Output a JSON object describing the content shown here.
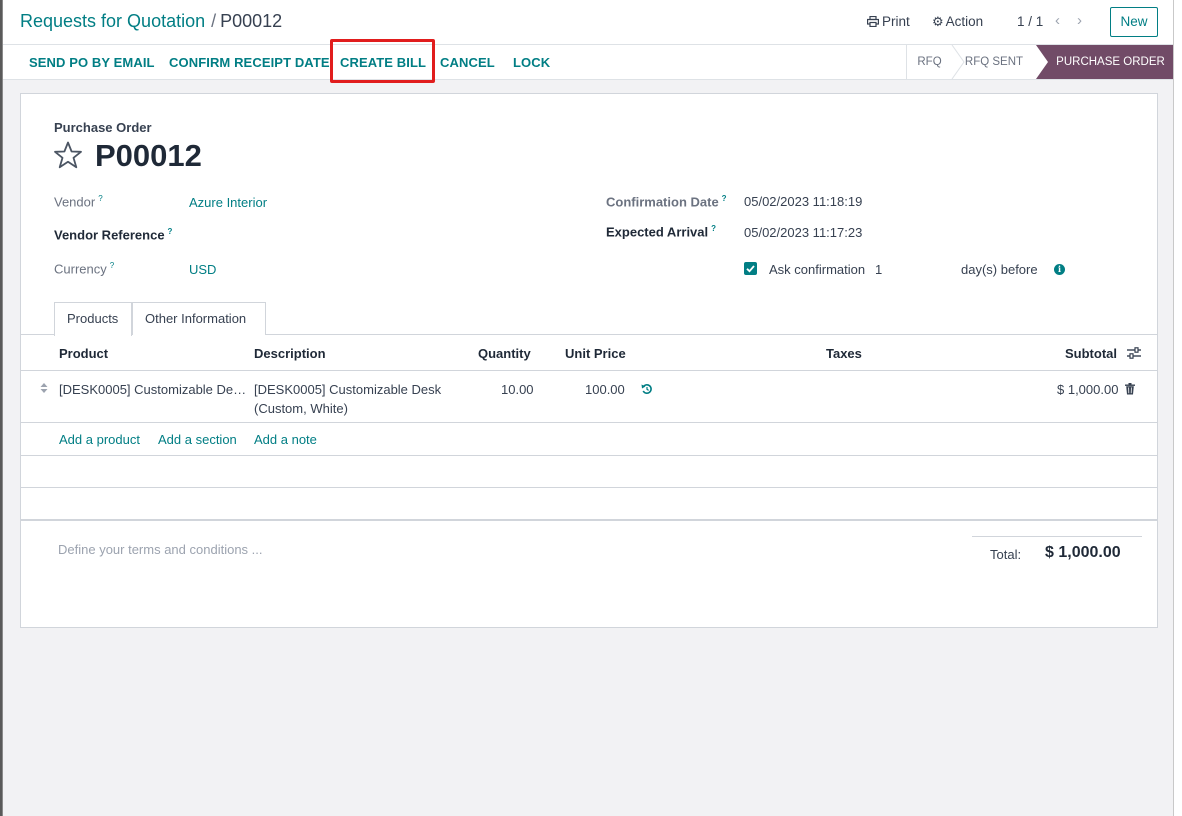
{
  "breadcrumb": {
    "parent": "Requests for Quotation",
    "separator": "/",
    "current": "P00012"
  },
  "header": {
    "print_label": "Print",
    "action_label": "Action",
    "pager": "1 / 1",
    "new_label": "New"
  },
  "statusbar": {
    "buttons": [
      "SEND PO BY EMAIL",
      "CONFIRM RECEIPT DATE",
      "CREATE BILL",
      "CANCEL",
      "LOCK"
    ],
    "stages": [
      "RFQ",
      "RFQ SENT",
      "PURCHASE ORDER"
    ],
    "active_stage": "PURCHASE ORDER",
    "highlighted_button": "CREATE BILL"
  },
  "form": {
    "type_label": "Purchase Order",
    "name": "P00012",
    "vendor_label": "Vendor",
    "vendor_value": "Azure Interior",
    "vendor_ref_label": "Vendor Reference",
    "currency_label": "Currency",
    "currency_value": "USD",
    "confirmation_date_label": "Confirmation Date",
    "confirmation_date_value": "05/02/2023 11:18:19",
    "expected_arrival_label": "Expected Arrival",
    "expected_arrival_value": "05/02/2023 11:17:23",
    "ask_confirmation_label": "Ask confirmation",
    "ask_confirmation_days": "1",
    "days_before_label": "day(s) before",
    "help_mark": "?"
  },
  "tabs": [
    "Products",
    "Other Information"
  ],
  "table": {
    "headers": [
      "Product",
      "Description",
      "Quantity",
      "Unit Price",
      "Taxes",
      "Subtotal"
    ],
    "rows": [
      {
        "product": "[DESK0005] Customizable De…",
        "description_1": "[DESK0005] Customizable Desk",
        "description_2": "(Custom, White)",
        "quantity": "10.00",
        "unit_price": "100.00",
        "subtotal": "$ 1,000.00"
      }
    ],
    "add_links": [
      "Add a product",
      "Add a section",
      "Add a note"
    ]
  },
  "footer": {
    "terms_placeholder": "Define your terms and conditions ...",
    "total_label": "Total:",
    "total_value": "$ 1,000.00"
  },
  "colors": {
    "accent": "#017e84",
    "stage_active": "#714b67",
    "highlight": "#e11d1d"
  }
}
